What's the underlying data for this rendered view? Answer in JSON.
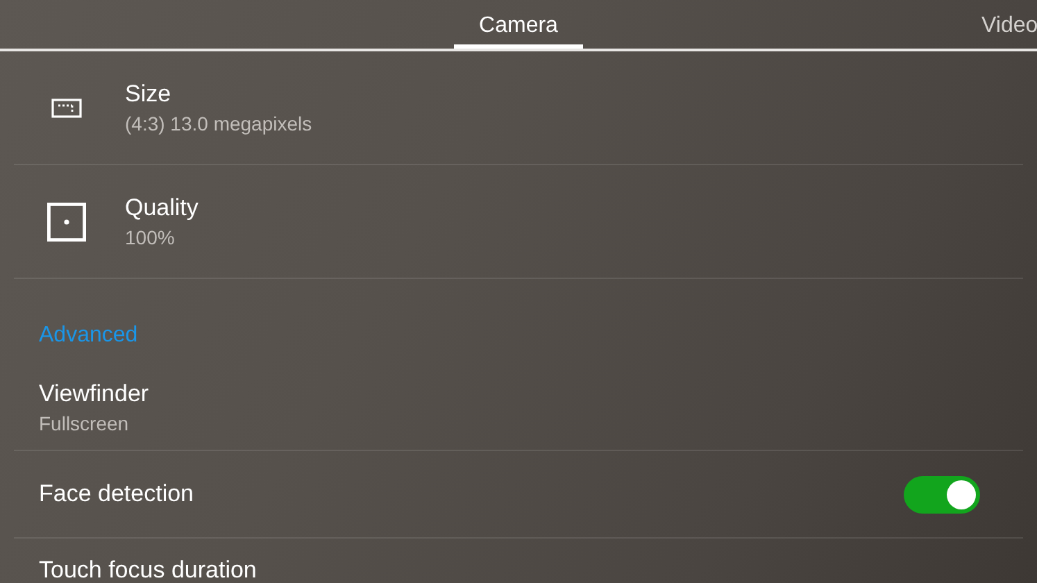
{
  "tabs": [
    {
      "label": "Camera",
      "selected": true
    },
    {
      "label": "Video",
      "selected": false
    }
  ],
  "items": [
    {
      "kind": "icon_setting",
      "title": "Size",
      "value": "(4:3) 13.0 megapixels"
    },
    {
      "kind": "icon_setting",
      "title": "Quality",
      "value": "100%"
    },
    {
      "kind": "header",
      "title": "Advanced"
    },
    {
      "kind": "setting",
      "title": "Viewfinder",
      "value": "Fullscreen"
    },
    {
      "kind": "toggle",
      "title": "Face detection",
      "on": true
    },
    {
      "kind": "setting",
      "title": "Touch focus duration"
    }
  ]
}
